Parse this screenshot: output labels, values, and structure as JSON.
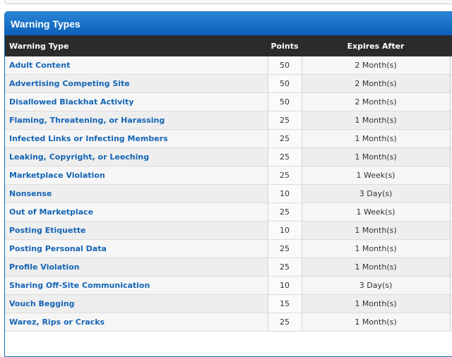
{
  "panel": {
    "title": "Warning Types"
  },
  "table": {
    "headers": {
      "type": "Warning Type",
      "points": "Points",
      "expires": "Expires After"
    },
    "rows": [
      {
        "type": "Adult Content",
        "points": "50",
        "expires": "2 Month(s)"
      },
      {
        "type": "Advertising Competing Site",
        "points": "50",
        "expires": "2 Month(s)"
      },
      {
        "type": "Disallowed Blackhat Activity",
        "points": "50",
        "expires": "2 Month(s)"
      },
      {
        "type": "Flaming, Threatening, or Harassing",
        "points": "25",
        "expires": "1 Month(s)"
      },
      {
        "type": "Infected Links or Infecting Members",
        "points": "25",
        "expires": "1 Month(s)"
      },
      {
        "type": "Leaking, Copyright, or Leeching",
        "points": "25",
        "expires": "1 Month(s)"
      },
      {
        "type": "Marketplace Violation",
        "points": "25",
        "expires": "1 Week(s)"
      },
      {
        "type": "Nonsense",
        "points": "10",
        "expires": "3 Day(s)"
      },
      {
        "type": "Out of Marketplace",
        "points": "25",
        "expires": "1 Week(s)"
      },
      {
        "type": "Posting Etiquette",
        "points": "10",
        "expires": "1 Month(s)"
      },
      {
        "type": "Posting Personal Data",
        "points": "25",
        "expires": "1 Month(s)"
      },
      {
        "type": "Profile Violation",
        "points": "25",
        "expires": "1 Month(s)"
      },
      {
        "type": "Sharing Off-Site Communication",
        "points": "10",
        "expires": "3 Day(s)"
      },
      {
        "type": "Vouch Begging",
        "points": "15",
        "expires": "1 Month(s)"
      },
      {
        "type": "Warez, Rips or Cracks",
        "points": "25",
        "expires": "1 Month(s)"
      }
    ]
  },
  "colors": {
    "header_blue": "#0c66c2",
    "column_header_bg": "#2b2b2b",
    "link_blue": "#1565b5"
  }
}
